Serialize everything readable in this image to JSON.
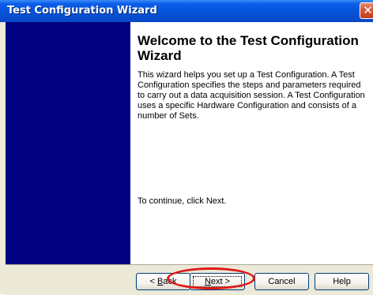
{
  "window": {
    "title": "Test Configuration Wizard",
    "close_symbol": "✕"
  },
  "content": {
    "heading": "Welcome to the Test Configuration Wizard",
    "description": "This wizard helps you set up a Test Configuration. A Test Configuration specifies the steps and parameters required to carry out a data acquisition session. A Test Configuration uses a specific Hardware Configuration and consists of a number of Sets.",
    "continue_text": "To continue, click Next."
  },
  "buttons": {
    "back": {
      "mnemonic": "B",
      "rest": "ack",
      "prefix": "< "
    },
    "next": {
      "mnemonic": "N",
      "rest": "ext",
      "suffix": " >"
    },
    "cancel": "Cancel",
    "help": "Help"
  },
  "colors": {
    "sidebar": "#000080",
    "highlight_circle": "#e01818",
    "titlebar": "#0553d8"
  }
}
